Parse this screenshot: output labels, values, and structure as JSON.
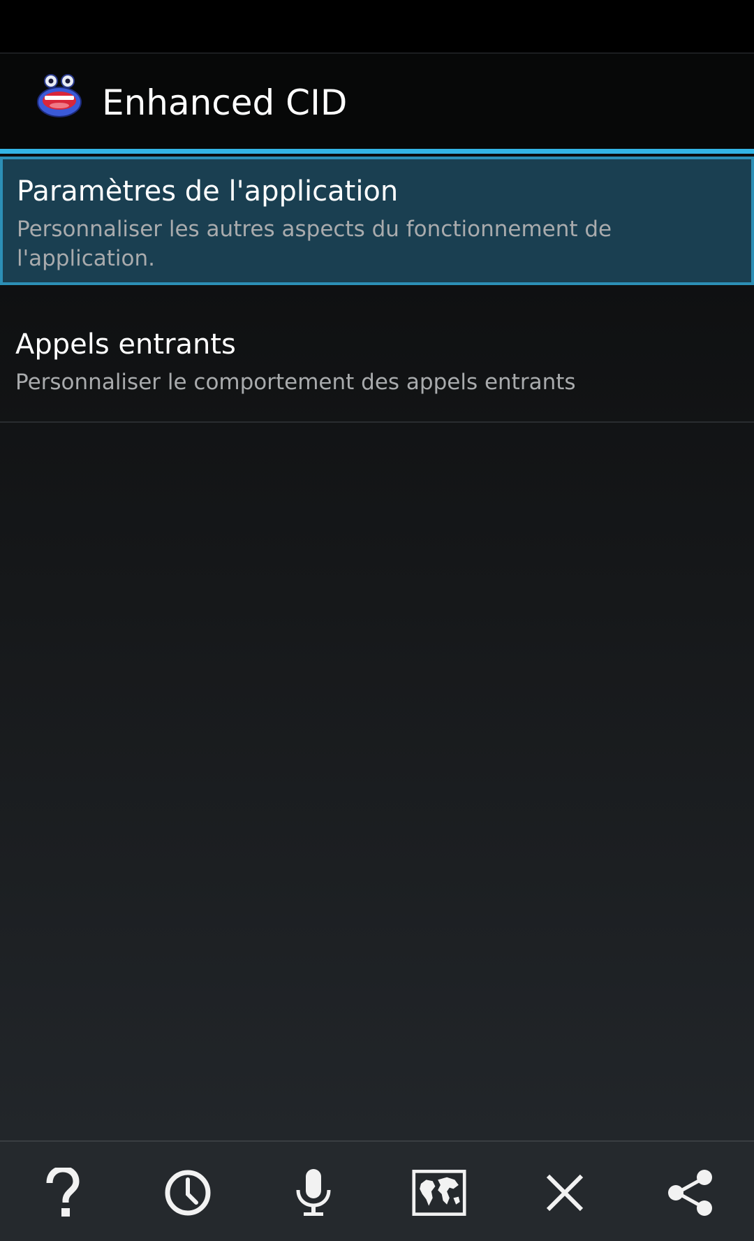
{
  "app": {
    "title": "Enhanced CID",
    "icon": "app-mascot-icon"
  },
  "preferences": [
    {
      "title": "Paramètres de l'application",
      "summary": "Personnaliser les autres aspects du fonctionnement de l'application.",
      "selected": true
    },
    {
      "title": "Appels entrants",
      "summary": "Personnaliser le comportement des appels entrants",
      "selected": false
    }
  ],
  "bottom_bar": {
    "buttons": [
      "help-icon",
      "clock-icon",
      "microphone-icon",
      "world-map-icon",
      "close-icon",
      "share-icon"
    ]
  },
  "colors": {
    "accent": "#33b5e5",
    "selected_bg": "#1a3f51",
    "summary_text": "#a9abad"
  }
}
